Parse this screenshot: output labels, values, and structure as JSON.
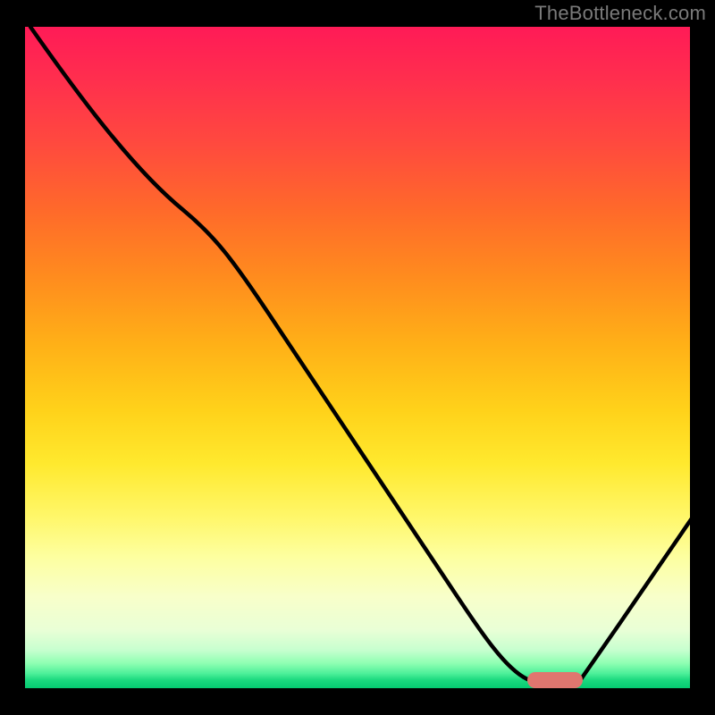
{
  "attribution": "TheBottleneck.com",
  "chart_data": {
    "type": "line",
    "title": "",
    "xlabel": "",
    "ylabel": "",
    "xlim": [
      0,
      100
    ],
    "ylim": [
      0,
      100
    ],
    "series": [
      {
        "name": "bottleneck-curve",
        "x": [
          0,
          12,
          24,
          36,
          48,
          60,
          72,
          76,
          82,
          88,
          94,
          100
        ],
        "values": [
          100,
          90,
          80,
          62,
          44,
          26,
          8,
          2,
          0,
          0,
          10,
          22
        ]
      }
    ],
    "optimal_zone": {
      "x_start": 76,
      "x_end": 84
    },
    "gradient_stops": [
      {
        "pos": 0,
        "color": "#ff1a57"
      },
      {
        "pos": 0.5,
        "color": "#ffd21a"
      },
      {
        "pos": 0.9,
        "color": "#f8ffca"
      },
      {
        "pos": 1.0,
        "color": "#00c66e"
      }
    ]
  }
}
